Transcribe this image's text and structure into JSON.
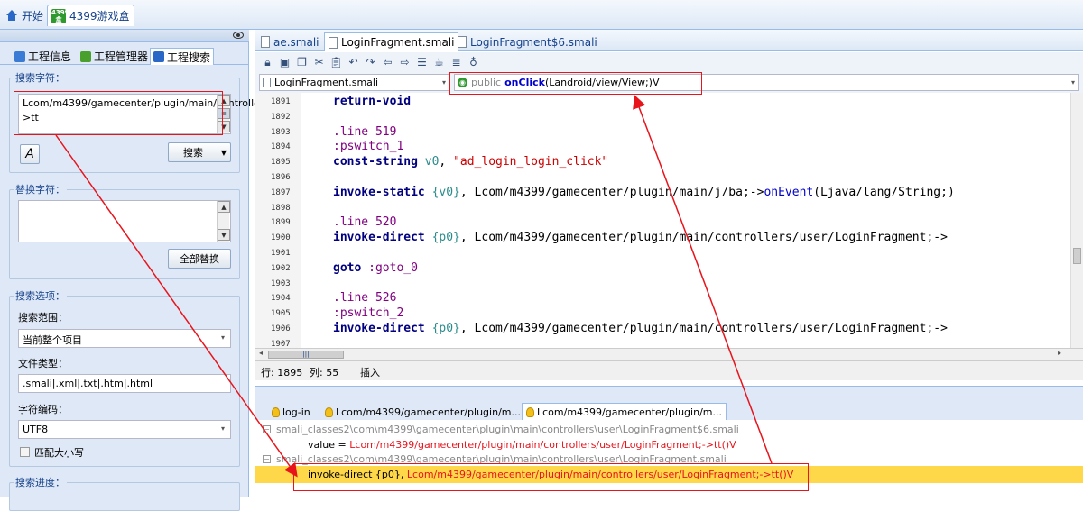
{
  "top_tabs": [
    {
      "label": "开始",
      "icon": "home-icon"
    },
    {
      "label": "4399游戏盒",
      "icon": "app-icon"
    }
  ],
  "left_panel": {
    "tabs": [
      {
        "label": "工程信息",
        "icon": "project-info-icon"
      },
      {
        "label": "工程管理器",
        "icon": "project-manager-icon"
      },
      {
        "label": "工程搜索",
        "icon": "project-search-icon"
      }
    ],
    "search_group": {
      "legend": "搜索字符：",
      "value": "Lcom/m4399/gamecenter/plugin/main/controllers/user/LoginFragment;->tt",
      "search_button": "搜索"
    },
    "replace_group": {
      "legend": "替换字符：",
      "value": "",
      "replace_all_button": "全部替换"
    },
    "options_group": {
      "legend": "搜索选项：",
      "scope_label": "搜索范围：",
      "scope_value": "当前整个项目",
      "filetype_label": "文件类型：",
      "filetype_value": ".smali|.xml|.txt|.htm|.html",
      "encoding_label": "字符编码：",
      "encoding_value": "UTF8",
      "match_case_label": "匹配大小写",
      "match_case_checked": false
    },
    "progress_group": {
      "legend": "搜索进度："
    }
  },
  "editor": {
    "tabs": [
      {
        "label": "ae.smali",
        "active": false
      },
      {
        "label": "LoginFragment.smali",
        "active": true
      },
      {
        "label": "LoginFragment$6.smali",
        "active": false
      }
    ],
    "file_select": "LoginFragment.smali",
    "method_select": {
      "prefix": "public",
      "name": "onClick",
      "signature": "(Landroid/view/View;)V"
    },
    "lines": [
      {
        "n": "1891",
        "tokens": [
          {
            "t": "return-void",
            "c": "kw"
          }
        ]
      },
      {
        "n": "1892",
        "tokens": []
      },
      {
        "n": "1893",
        "tokens": [
          {
            "t": ".line",
            "c": "dir"
          },
          {
            "t": " 519",
            "c": "dir"
          }
        ]
      },
      {
        "n": "1894",
        "tokens": [
          {
            "t": ":pswitch_1",
            "c": "dir"
          }
        ]
      },
      {
        "n": "1895",
        "tokens": [
          {
            "t": "const-string",
            "c": "kw"
          },
          {
            "t": " v0",
            "c": "reg"
          },
          {
            "t": ", ",
            "c": ""
          },
          {
            "t": "\"ad_login_login_click\"",
            "c": "str"
          }
        ]
      },
      {
        "n": "1896",
        "tokens": []
      },
      {
        "n": "1897",
        "tokens": [
          {
            "t": "invoke-static",
            "c": "kw"
          },
          {
            "t": " {v0}",
            "c": "reg"
          },
          {
            "t": ", Lcom/m4399/gamecenter/plugin/main/j/ba;->",
            "c": ""
          },
          {
            "t": "onEvent",
            "c": "fn"
          },
          {
            "t": "(Ljava/lang/String;)",
            "c": ""
          }
        ]
      },
      {
        "n": "1898",
        "tokens": []
      },
      {
        "n": "1899",
        "tokens": [
          {
            "t": ".line",
            "c": "dir"
          },
          {
            "t": " 520",
            "c": "dir"
          }
        ]
      },
      {
        "n": "1900",
        "tokens": [
          {
            "t": "invoke-direct",
            "c": "kw"
          },
          {
            "t": " {p0}",
            "c": "reg"
          },
          {
            "t": ", Lcom/m4399/gamecenter/plugin/main/controllers/user/LoginFragment;->",
            "c": ""
          }
        ]
      },
      {
        "n": "1901",
        "tokens": []
      },
      {
        "n": "1902",
        "tokens": [
          {
            "t": "goto",
            "c": "kw"
          },
          {
            "t": " :goto_0",
            "c": "dir"
          }
        ]
      },
      {
        "n": "1903",
        "tokens": []
      },
      {
        "n": "1904",
        "tokens": [
          {
            "t": ".line",
            "c": "dir"
          },
          {
            "t": " 526",
            "c": "dir"
          }
        ]
      },
      {
        "n": "1905",
        "tokens": [
          {
            "t": ":pswitch_2",
            "c": "dir"
          }
        ]
      },
      {
        "n": "1906",
        "tokens": [
          {
            "t": "invoke-direct",
            "c": "kw"
          },
          {
            "t": " {p0}",
            "c": "reg"
          },
          {
            "t": ", Lcom/m4399/gamecenter/plugin/main/controllers/user/LoginFragment;->",
            "c": ""
          }
        ]
      },
      {
        "n": "1907",
        "tokens": []
      }
    ],
    "status": {
      "row": "行: 1895",
      "col": "列: 55",
      "mode": "插入"
    }
  },
  "results": {
    "tabs": [
      {
        "label": "log-in",
        "active": false
      },
      {
        "label": "Lcom/m4399/gamecenter/plugin/m...",
        "active": false
      },
      {
        "label": "Lcom/m4399/gamecenter/plugin/m...",
        "active": true
      }
    ],
    "rows": [
      {
        "type": "file",
        "text": "smali_classes2\\com\\m4399\\gamecenter\\plugin\\main\\controllers\\user\\LoginFragment$6.smali"
      },
      {
        "type": "match",
        "prefix": "value = ",
        "match": "Lcom/m4399/gamecenter/plugin/main/controllers/user/LoginFragment;->tt()V",
        "highlighted": false
      },
      {
        "type": "file",
        "text": "smali_classes2\\com\\m4399\\gamecenter\\plugin\\main\\controllers\\user\\LoginFragment.smali"
      },
      {
        "type": "match",
        "prefix": "invoke-direct {p0}, ",
        "match": "Lcom/m4399/gamecenter/plugin/main/controllers/user/LoginFragment;->tt()V",
        "highlighted": true
      }
    ]
  },
  "colors": {
    "accent": "#15428b",
    "annotation": "#e8141c",
    "highlight": "#ffd84a"
  }
}
